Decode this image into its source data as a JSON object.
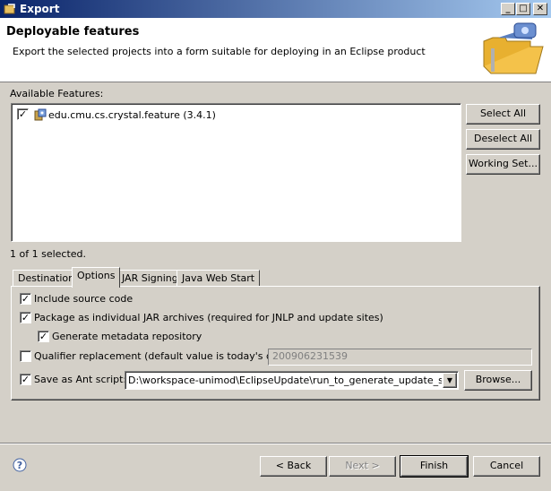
{
  "window": {
    "title": "Export"
  },
  "header": {
    "title": "Deployable features",
    "description": "Export the selected projects into a form suitable for deploying in an Eclipse product"
  },
  "features": {
    "label": "Available Features:",
    "items": [
      {
        "label": "edu.cmu.cs.crystal.feature (3.4.1)",
        "checked": true
      }
    ],
    "count": "1 of 1 selected.",
    "select_all": "Select All",
    "deselect_all": "Deselect All",
    "working_set": "Working Set..."
  },
  "tabs": [
    {
      "label": "Destination",
      "active": false
    },
    {
      "label": "Options",
      "active": true
    },
    {
      "label": "JAR Signing",
      "active": false
    },
    {
      "label": "Java Web Start",
      "active": false
    }
  ],
  "options": {
    "include_source": {
      "label": "Include source code",
      "checked": true
    },
    "package_jars": {
      "label": "Package as individual JAR archives (required for JNLP and update sites)",
      "checked": true
    },
    "metadata": {
      "label": "Generate metadata repository",
      "checked": true
    },
    "qualifier": {
      "label": "Qualifier replacement (default value is today's date):",
      "checked": false,
      "value": "200906231539"
    },
    "ant_script": {
      "label": "Save as Ant script:",
      "checked": true,
      "value": "D:\\workspace-unimod\\EclipseUpdate\\run_to_generate_update_site.xml",
      "browse": "Browse..."
    }
  },
  "footer": {
    "back": "< Back",
    "next": "Next >",
    "finish": "Finish",
    "cancel": "Cancel"
  },
  "colors": {
    "title_start": "#0a246a",
    "title_end": "#a6caf0",
    "face": "#d4d0c8"
  }
}
